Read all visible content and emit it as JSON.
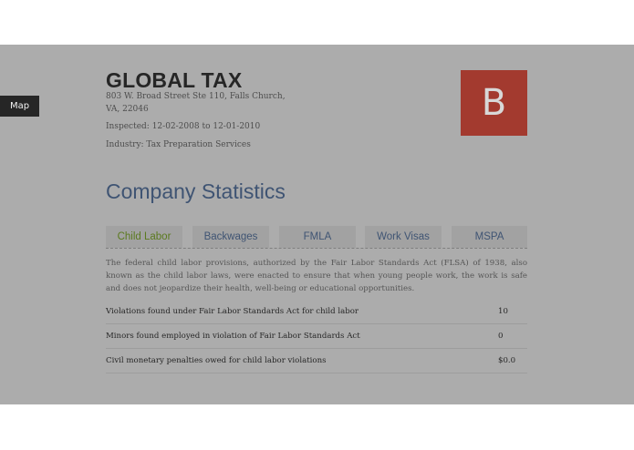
{
  "nav": {
    "map_label": "Map"
  },
  "company": {
    "name": "GLOBAL TAX",
    "address": "803 W. Broad Street Ste 110, Falls Church, VA, 22046",
    "inspected": "Inspected: 12-02-2008 to 12-01-2010",
    "industry": "Industry: Tax Preparation Services",
    "grade": "B"
  },
  "colors": {
    "panel": "#acacac",
    "grade_badge": "#a33a2f",
    "title_blue": "#3f5473",
    "active_tab_green": "#5b7a1f"
  },
  "statistics": {
    "title": "Company Statistics",
    "tabs": [
      {
        "label": "Child Labor",
        "active": true
      },
      {
        "label": "Backwages",
        "active": false
      },
      {
        "label": "FMLA",
        "active": false
      },
      {
        "label": "Work Visas",
        "active": false
      },
      {
        "label": "MSPA",
        "active": false
      }
    ],
    "description": "The federal child labor provisions, authorized by the Fair Labor Standards Act (FLSA) of 1938, also known as the child labor laws, were enacted to ensure that when young people work, the work is safe and does not jeopardize their health, well-being or educational opportunities.",
    "rows": [
      {
        "label": "Violations found under Fair Labor Standards Act for child labor",
        "value": "10"
      },
      {
        "label": "Minors found employed in violation of Fair Labor Standards Act",
        "value": "0"
      },
      {
        "label": "Civil monetary penalties owed for child labor violations",
        "value": "$0.0"
      }
    ]
  }
}
